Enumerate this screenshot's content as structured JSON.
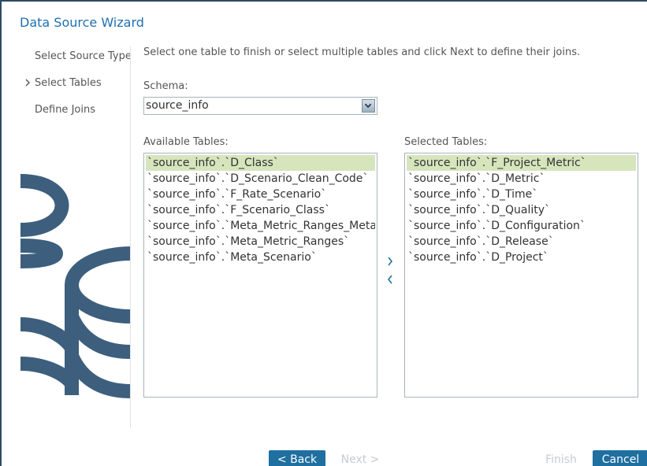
{
  "window": {
    "title": "Data Source Wizard"
  },
  "nav": {
    "items": [
      {
        "label": "Select Source Type"
      },
      {
        "label": "Select Tables"
      },
      {
        "label": "Define Joins"
      }
    ]
  },
  "main": {
    "instructions": "Select one table to finish or select multiple tables and click Next to define their joins.",
    "schema_label": "Schema:",
    "schema_value": "source_info",
    "available_label": "Available Tables:",
    "available": [
      "`source_info`.`D_Class`",
      "`source_info`.`D_Scenario_Clean_Code`",
      "`source_info`.`F_Rate_Scenario`",
      "`source_info`.`F_Scenario_Class`",
      "`source_info`.`Meta_Metric_Ranges_Meta_Sc",
      "`source_info`.`Meta_Metric_Ranges`",
      "`source_info`.`Meta_Scenario`"
    ],
    "selected_label": "Selected Tables:",
    "selected": [
      "`source_info`.`F_Project_Metric`",
      "`source_info`.`D_Metric`",
      "`source_info`.`D_Time`",
      "`source_info`.`D_Quality`",
      "`source_info`.`D_Configuration`",
      "`source_info`.`D_Release`",
      "`source_info`.`D_Project`"
    ]
  },
  "footer": {
    "back_label": "< Back",
    "next_label": "Next >",
    "finish_label": "Finish",
    "cancel_label": "Cancel"
  },
  "colors": {
    "accent": "#1f6fa0",
    "title": "#1f6fb0",
    "selection": "#d6e5bc",
    "graphic": "#3d5f7d"
  },
  "icons": [
    "chevron-right-icon",
    "dropdown-arrow-icon",
    "move-right-icon",
    "move-left-icon",
    "database-graphic"
  ]
}
